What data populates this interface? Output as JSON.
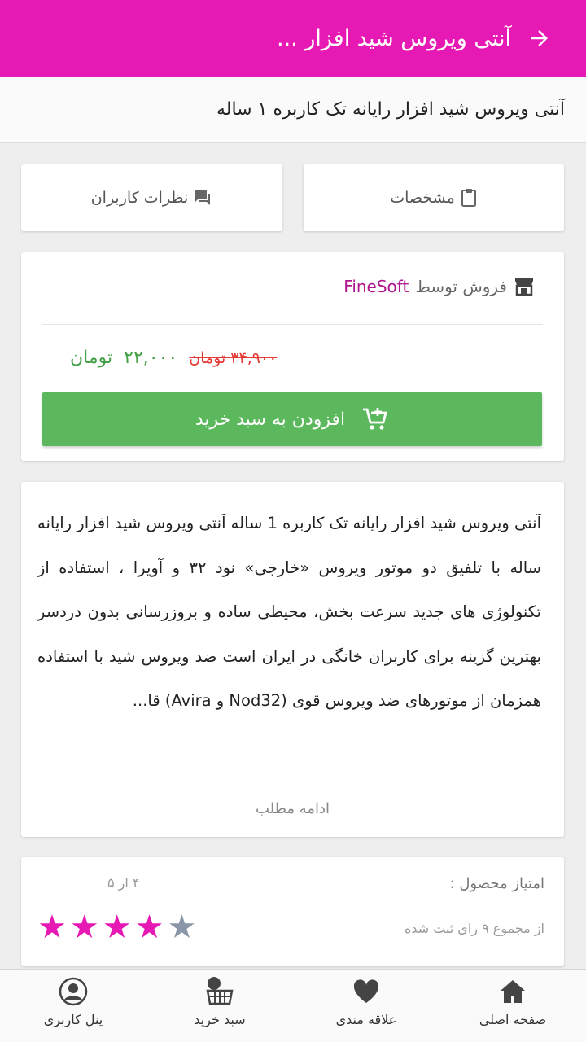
{
  "appbar": {
    "title": "آنتی ویروس شید افزار ..."
  },
  "product": {
    "full_title": "آنتی ویروس شید افزار رایانه تک کاربره ۱ ساله"
  },
  "tabs": {
    "specs_label": "مشخصات",
    "reviews_label": "نظرات کاربران"
  },
  "seller": {
    "prefix": "فروش توسط",
    "name": "FineSoft"
  },
  "price": {
    "new_price": "۲۲,۰۰۰",
    "currency": "تومان",
    "old_price": "۳۴,۹۰۰ تومان"
  },
  "add_to_cart_label": "افزودن به سبد خرید",
  "description": {
    "text": "آنتی ویروس شید افزار رایانه تک کاربره 1 ساله آنتی ویروس شید افزار رایانه ساله با تلفیق دو موتور ویروس «خارجی» نود ۳۲ و آویرا ، استفاده از تکنولوژی های جدید سرعت بخش، محیطی ساده و بروزرسانی بدون دردسر بهترین گزینه برای کاربران خانگی در ایران است ضد ویروس شید با استفاده همزمان از موتورهای ضد ویروس قوی (Nod32 و Avira) قا...",
    "more_label": "ادامه مطلب"
  },
  "rating": {
    "label": "امتیاز محصول :",
    "count_text": "از مجموع ۹ رای ثبت شده",
    "score_text": "۴ از ۵",
    "value": 4,
    "max": 5
  },
  "colors": {
    "brand": "#e619b4",
    "star_filled": "#e619b4",
    "star_empty": "#8a95a8",
    "add_to_cart": "#5cb85c",
    "price_new": "#43a047",
    "price_old": "#e53935"
  },
  "bottom_nav": {
    "home": "صفحه اصلی",
    "favorites": "علاقه مندی",
    "cart": "سبد خرید",
    "profile": "پنل کاربری"
  }
}
